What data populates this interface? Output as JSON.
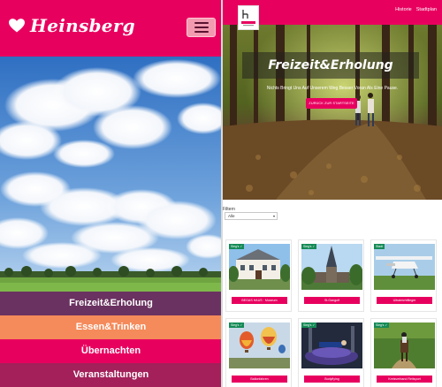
{
  "mobile": {
    "brand": {
      "name": "Heinsberg",
      "icon": "heart-icon"
    },
    "menu_button": {
      "icon": "hamburger-icon"
    },
    "menu": [
      {
        "label": "Freizeit&Erholung",
        "color": "#6a3260"
      },
      {
        "label": "Essen&Trinken",
        "color": "#f58a5a"
      },
      {
        "label": "Übernachten",
        "color": "#e8005f"
      },
      {
        "label": "Veranstaltungen",
        "color": "#a3205a"
      }
    ]
  },
  "desktop": {
    "logo": {
      "icon": "heinsberg-logo-icon"
    },
    "top_links": [
      "Historie",
      "Stadtplan"
    ],
    "hero": {
      "title": "Freizeit&Erholung",
      "subtitle": "Nichts Bringt Uns Auf Unserem Weg Besser Voran Als Eine Pause.",
      "button_label": "ZURÜCK ZUR STARTSEITE"
    },
    "filter": {
      "label": "Filtern",
      "selected": "Alle"
    },
    "cards": [
      {
        "badge": "Sieg's ✓",
        "button_label": "BEGAS HAUS · Museum"
      },
      {
        "badge": "Sieg's ✓",
        "button_label": "St.Gangolf"
      },
      {
        "badge": "Stadt",
        "button_label": "Ultraleichtflieger"
      },
      {
        "badge": "Sieg's ✓",
        "button_label": "Ballonfahren"
      },
      {
        "badge": "Sieg's ✓",
        "button_label": "Bodyflying"
      },
      {
        "badge": "Sieg's ✓",
        "button_label": "Kreisverband Reitsport"
      }
    ]
  },
  "colors": {
    "brand": "#e8005f",
    "badge": "#148a56"
  }
}
